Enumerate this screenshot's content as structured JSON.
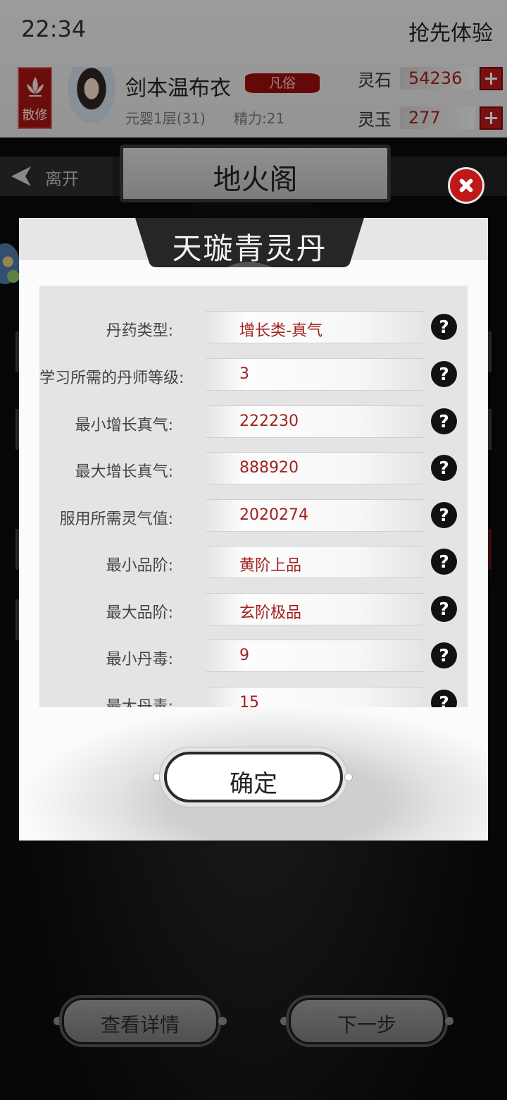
{
  "status_bar": {
    "time": "22:34",
    "right_text": "抢先体验"
  },
  "player": {
    "rank_badge": "散修",
    "name": "剑本温布衣",
    "title_tag": "凡俗",
    "level": "元婴1层(31)",
    "energy": "精力:21"
  },
  "currency": [
    {
      "label": "灵石",
      "value": "54236"
    },
    {
      "label": "灵玉",
      "value": "277"
    }
  ],
  "nav": {
    "leave_label": "离开",
    "hall_title": "地火阁"
  },
  "dialog": {
    "title": "天璇青灵丹",
    "rows": [
      {
        "label": "丹药类型:",
        "value": "增长类-真气"
      },
      {
        "label": "学习所需的丹师等级:",
        "value": "3"
      },
      {
        "label": "最小增长真气:",
        "value": "222230"
      },
      {
        "label": "最大增长真气:",
        "value": "888920"
      },
      {
        "label": "服用所需灵气值:",
        "value": "2020274"
      },
      {
        "label": "最小品阶:",
        "value": "黄阶上品"
      },
      {
        "label": "最大品阶:",
        "value": "玄阶极品"
      },
      {
        "label": "最小丹毒:",
        "value": "9"
      },
      {
        "label": "最大丹毒:",
        "value": "15"
      }
    ],
    "help_glyph": "?",
    "confirm_label": "确定"
  },
  "bottom_buttons": {
    "details_label": "查看详情",
    "next_label": "下一步"
  },
  "colors": {
    "accent_red": "#b81b1b",
    "value_red": "#a32020",
    "dialog_bg": "#fbfbfb",
    "panel_bg": "#e4e4e4"
  }
}
